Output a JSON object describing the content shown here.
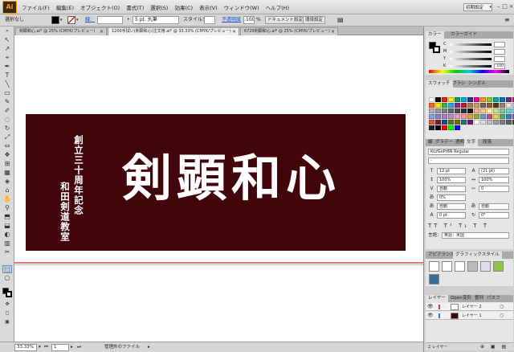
{
  "app": {
    "logo": "Ai",
    "menu": [
      "ファイル(F)",
      "編集(E)",
      "オブジェクト(O)",
      "書式(T)",
      "選択(S)",
      "効果(C)",
      "表示(V)",
      "ウィンドウ(W)",
      "ヘルプ(H)"
    ],
    "workspace": "初期設定",
    "window_controls": [
      "–",
      "□",
      "×"
    ]
  },
  "control_bar": {
    "selection_label": "選択なし",
    "stroke_label": "線：",
    "brush_value": "5 pt. 丸筆",
    "style_label": "スタイル：",
    "opacity_label": "不透明度",
    "opacity_value": "100",
    "opacity_unit": "%",
    "doc_setup": "ドキュメント設定",
    "prefs": "環境設定"
  },
  "tabs": [
    {
      "label": "剣顕和心.ai* @ 25% (CMYK/プレビュー)",
      "active": false
    },
    {
      "label": "1200手拭い(剣顕和心)注文用.ai* @ 33.33% (CMYK/プレビュー)",
      "active": true
    },
    {
      "label": "6729剣顕和心.ai* @ 25% (CMYK/プレビュー)",
      "active": false
    }
  ],
  "tools": [
    "↖",
    "↗",
    "⌖",
    "✒",
    "T",
    "╲",
    "▭",
    "✎",
    "✐",
    "◌",
    "↻",
    "⤢",
    "⇔",
    "❖",
    "⊞",
    "▦",
    "◈",
    "⌂",
    "✋",
    "⚲",
    "⬒",
    "⬓",
    "◐",
    "▥",
    "✂",
    "⬚",
    "⎔",
    "✥",
    "◻",
    "▣",
    "⛶",
    "⬛"
  ],
  "artwork": {
    "banner_color": "#43050c",
    "sub_text_1": "創立三十周年記念",
    "sub_text_2": "和田剣道教室",
    "main_title": "剣顕和心"
  },
  "status": {
    "zoom": "33.33%",
    "page": "1",
    "info": "管理外のファイル"
  },
  "panels": {
    "color": {
      "tabs": [
        "カラー",
        "カラーガイド"
      ],
      "channels": [
        {
          "ch": "C",
          "val": ""
        },
        {
          "ch": "M",
          "val": ""
        },
        {
          "ch": "Y",
          "val": ""
        },
        {
          "ch": "K",
          "val": "100"
        }
      ]
    },
    "swatch": {
      "tabs": [
        "スウォッチ",
        "ブラシ",
        "シンボル"
      ],
      "colors": [
        "#ffffff",
        "#000000",
        "#ed1c24",
        "#ffef00",
        "#00a651",
        "#00aeef",
        "#2e3192",
        "#ec008c",
        "#f7941d",
        "#8dc63f",
        "#00a99d",
        "#0072bc",
        "#662d91",
        "#c1272d",
        "#f26522",
        "#fff200",
        "#39b54a",
        "#29abe2",
        "#92278f",
        "#be1e2d",
        "#a67c52",
        "#c69c6d",
        "#736357",
        "#8b5e3c",
        "#603913",
        "#998675",
        "#e6e6e6",
        "#cccccc",
        "#b3b3b3",
        "#999999",
        "#808080",
        "#666666",
        "#4d4d4d",
        "#333333",
        "#1a1a1a",
        "#f9ad81",
        "#fdc689",
        "#fff799",
        "#c4df9b",
        "#82ca9c",
        "#7accc8",
        "#6dcff6",
        "#7da7d9",
        "#8781bd",
        "#a186be",
        "#bd8cbf",
        "#f49ac1",
        "#f5989d",
        "#d8a040",
        "#93ab3c",
        "#5c9ecf",
        "#c74e7a",
        "#e8d33f",
        "#47b06c",
        "#3d7bc3",
        "#9e4fa0",
        "#e4573d",
        "#7a1e1e",
        "#1e4e7a",
        "#4e7a1e",
        "#7a6a1e",
        "#1e7a6a",
        "#6a1e7a",
        "#ffffff",
        "#e0e0e0",
        "#c0c0c0",
        "#a0a0a0",
        "#808080",
        "#606060",
        "#404040",
        "#202020",
        "#000000",
        "#ff0000",
        "#00ff00",
        "#0000ff"
      ]
    },
    "character": {
      "tabs": [
        "線",
        "グラデー",
        "透明",
        "文字",
        "段落"
      ],
      "font": "KozGoPr6N Regular",
      "font_style": "-",
      "size": "12 pt",
      "leading": "(21 pt)",
      "vscale": "100%",
      "hscale": "100%",
      "kerning": "自動",
      "tracking": "0",
      "tsume": "0%",
      "aki1": "自動",
      "aki2": "自動",
      "baseline": "0 pt",
      "rotate": "0°",
      "lang_label": "言語：",
      "lang": "英語：米国"
    },
    "appearance": {
      "tabs": [
        "アピアランス",
        "グラフィックスタイル"
      ]
    },
    "layers": {
      "tabs": [
        "レイヤー",
        "Open",
        "変形",
        "整列",
        "パスフ"
      ],
      "rows": [
        "レイヤー 2",
        "レイヤー 1"
      ],
      "footer": "2 レイヤー"
    }
  }
}
